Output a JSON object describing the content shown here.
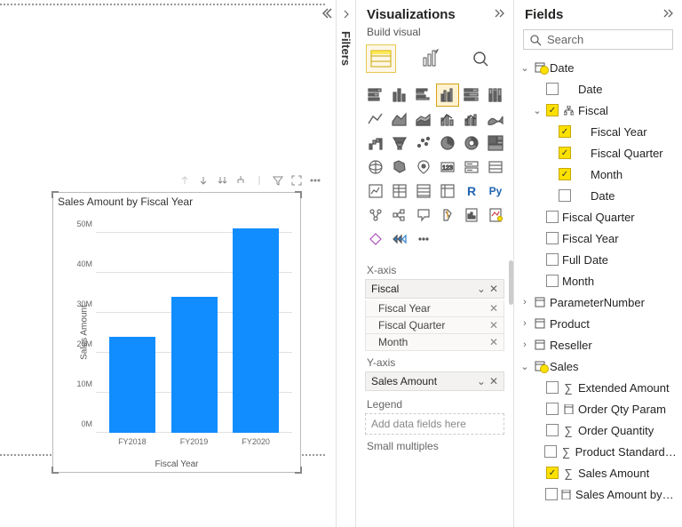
{
  "chart_data": {
    "type": "bar",
    "title": "Sales Amount by Fiscal Year",
    "xlabel": "Fiscal Year",
    "ylabel": "Sales Amount",
    "categories": [
      "FY2018",
      "FY2019",
      "FY2020"
    ],
    "values": [
      24000000,
      34000000,
      51000000
    ],
    "ylim": [
      0,
      55000000
    ],
    "yticks": [
      "0M",
      "10M",
      "20M",
      "30M",
      "40M",
      "50M"
    ]
  },
  "panes": {
    "filters": "Filters",
    "visualizations": "Visualizations",
    "build_visual": "Build visual",
    "fields_title": "Fields"
  },
  "wells": {
    "xaxis": {
      "label": "X-axis",
      "main": "Fiscal",
      "items": [
        "Fiscal Year",
        "Fiscal Quarter",
        "Month"
      ]
    },
    "yaxis": {
      "label": "Y-axis",
      "main": "Sales Amount"
    },
    "legend": {
      "label": "Legend",
      "placeholder": "Add data fields here"
    },
    "small_multiples": "Small multiples"
  },
  "search": {
    "placeholder": "Search"
  },
  "tree": {
    "date": {
      "label": "Date",
      "date": "Date",
      "fiscal": {
        "label": "Fiscal",
        "fy": "Fiscal Year",
        "fq": "Fiscal Quarter",
        "month": "Month",
        "date": "Date"
      },
      "fq2": "Fiscal Quarter",
      "fy2": "Fiscal Year",
      "full_date": "Full Date",
      "month2": "Month"
    },
    "param": "ParameterNumber",
    "product": "Product",
    "reseller": "Reseller",
    "sales": {
      "label": "Sales",
      "extended": "Extended Amount",
      "order_qty_param": "Order Qty Param",
      "order_qty": "Order Quantity",
      "std_cost": "Product Standard Cost",
      "sales_amount": "Sales Amount",
      "sales_du": "Sales Amount by Du..."
    }
  },
  "viz_types": [
    "stacked-bar",
    "stacked-column",
    "clustered-bar",
    "clustered-column",
    "100-stacked-bar",
    "100-stacked-column",
    "line",
    "area",
    "stacked-area",
    "line-stacked-column",
    "line-clustered-column",
    "ribbon",
    "waterfall",
    "funnel",
    "scatter",
    "pie",
    "donut",
    "treemap",
    "map",
    "filled-map",
    "azure-map",
    "gauge",
    "card",
    "multi-card",
    "kpi",
    "slicer",
    "table",
    "matrix",
    "r-visual",
    "python-visual",
    "key-influencers",
    "decomposition-tree",
    "qa",
    "narrative",
    "paginated",
    "power-apps",
    "power-automate",
    "more"
  ]
}
